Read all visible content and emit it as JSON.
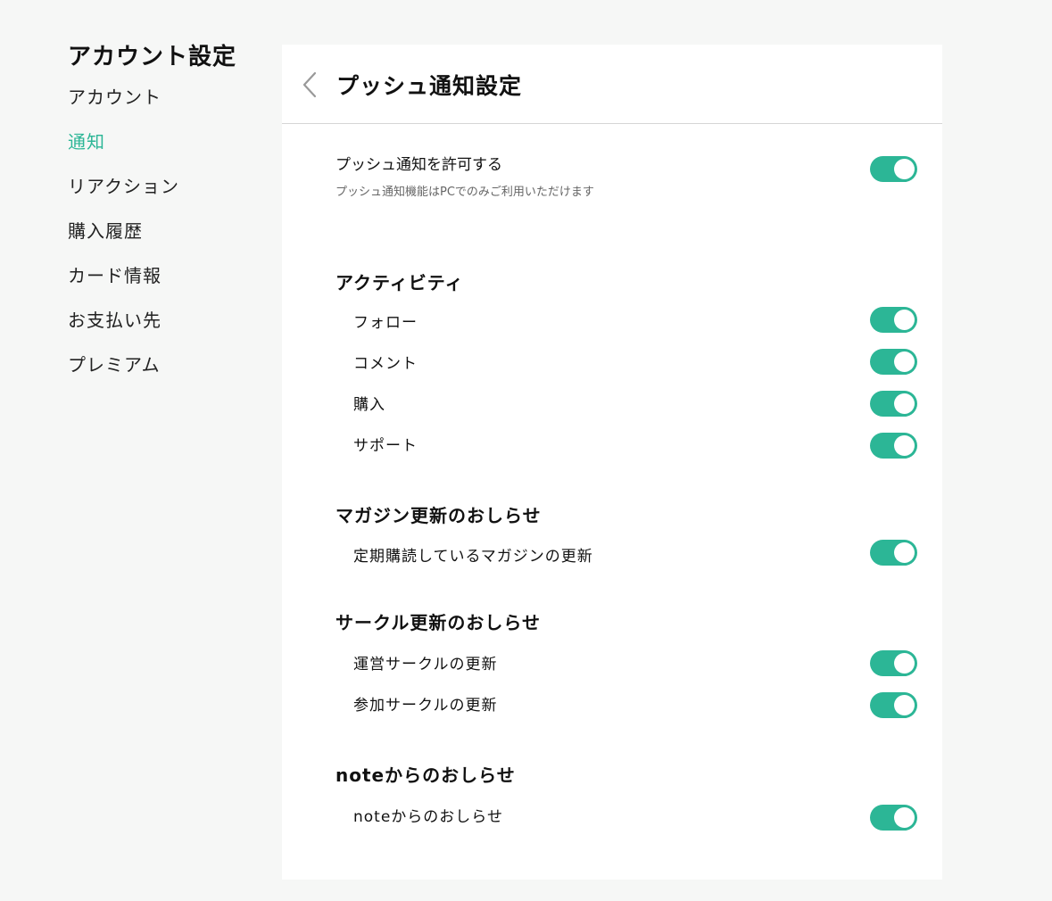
{
  "sidebar": {
    "title": "アカウント設定",
    "items": [
      {
        "label": "アカウント",
        "active": false
      },
      {
        "label": "通知",
        "active": true
      },
      {
        "label": "リアクション",
        "active": false
      },
      {
        "label": "購入履歴",
        "active": false
      },
      {
        "label": "カード情報",
        "active": false
      },
      {
        "label": "お支払い先",
        "active": false
      },
      {
        "label": "プレミアム",
        "active": false
      }
    ]
  },
  "panel": {
    "back_icon": "chevron-left-icon",
    "title": "プッシュ通知設定",
    "allow": {
      "label": "プッシュ通知を許可する",
      "note": "プッシュ通知機能はPCでのみご利用いただけます",
      "enabled": true
    },
    "sections": [
      {
        "title": "アクティビティ",
        "items": [
          {
            "label": "フォロー",
            "enabled": true
          },
          {
            "label": "コメント",
            "enabled": true
          },
          {
            "label": "購入",
            "enabled": true
          },
          {
            "label": "サポート",
            "enabled": true
          }
        ]
      },
      {
        "title": "マガジン更新のおしらせ",
        "items": [
          {
            "label": "定期購読しているマガジンの更新",
            "enabled": true
          }
        ]
      },
      {
        "title": "サークル更新のおしらせ",
        "items": [
          {
            "label": "運営サークルの更新",
            "enabled": true
          },
          {
            "label": "参加サークルの更新",
            "enabled": true
          }
        ]
      },
      {
        "title": "noteからのおしらせ",
        "items": [
          {
            "label": "noteからのおしらせ",
            "enabled": true
          }
        ]
      }
    ]
  },
  "colors": {
    "accent": "#2cb696",
    "page_background": "#f6f7f6",
    "panel_background": "#ffffff"
  }
}
